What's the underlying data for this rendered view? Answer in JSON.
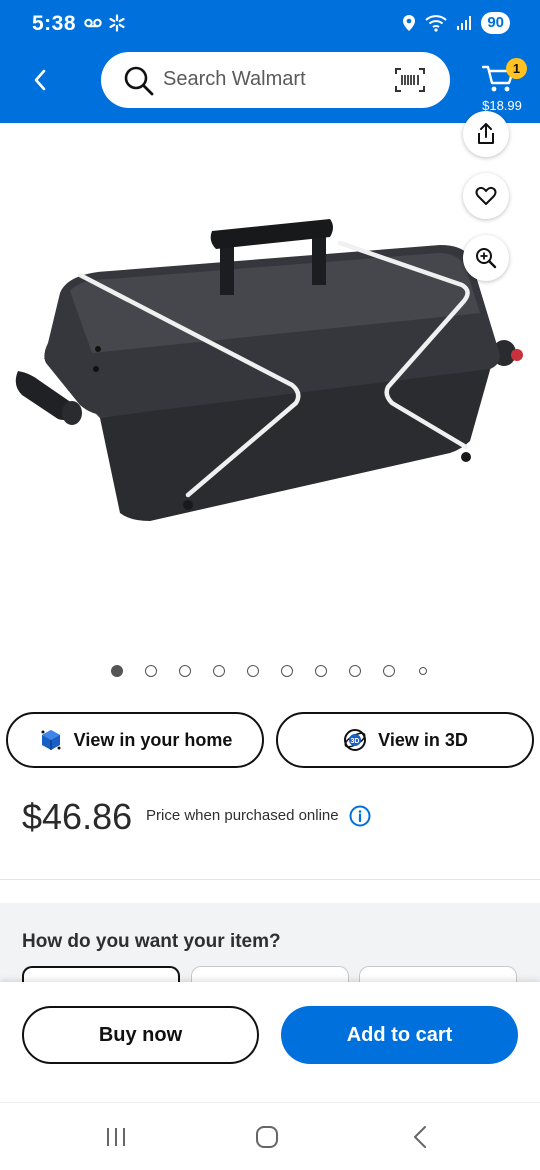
{
  "status_bar": {
    "time": "5:38",
    "battery": "90"
  },
  "header": {
    "search_placeholder": "Search Walmart",
    "cart_count": "1",
    "cart_total": "$18.99",
    "brand_color": "#0071dc",
    "badge_color": "#ffc220"
  },
  "gallery": {
    "image_count": 10,
    "active_index": 0
  },
  "view_buttons": {
    "home_label": "View in your home",
    "threed_label": "View in 3D"
  },
  "pricing": {
    "price": "$46.86",
    "note": "Price when purchased online"
  },
  "fulfillment": {
    "title": "How do you want your item?"
  },
  "actions": {
    "buy_now": "Buy now",
    "add_to_cart": "Add to cart"
  },
  "icons": [
    "back-arrow-icon",
    "search-icon",
    "barcode-icon",
    "cart-icon",
    "share-icon",
    "heart-icon",
    "zoom-icon",
    "ar-cube-icon",
    "3d-icon",
    "info-icon",
    "recents-icon",
    "home-icon",
    "nav-back-icon"
  ]
}
